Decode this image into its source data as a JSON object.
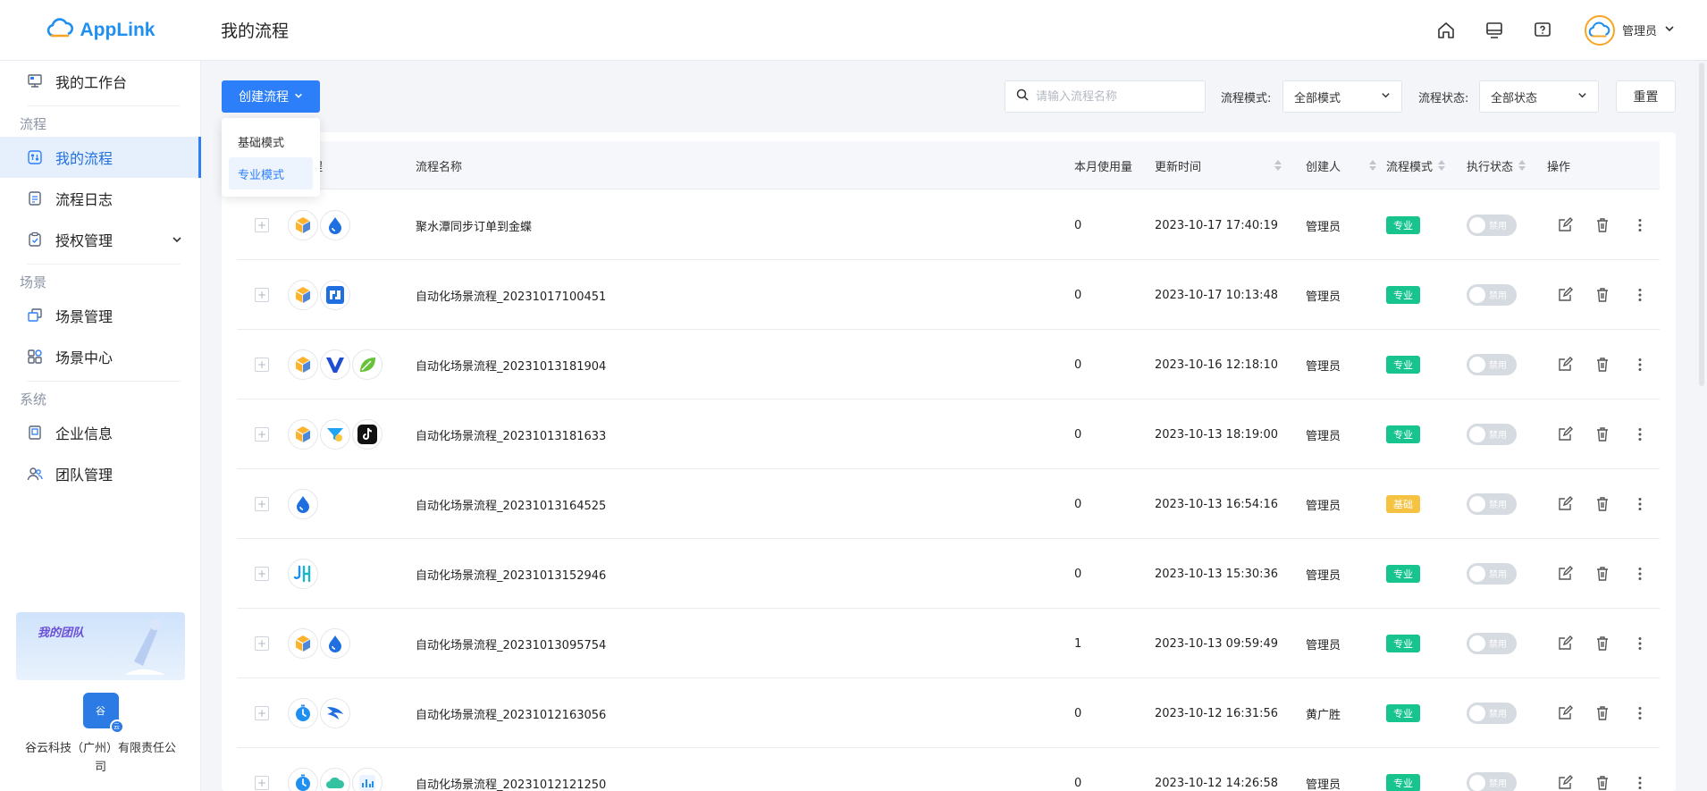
{
  "app": {
    "name": "AppLink",
    "page_title": "我的流程"
  },
  "header": {
    "user_name": "管理员"
  },
  "sidebar": {
    "top_item": "我的工作台",
    "sections": [
      {
        "label": "流程",
        "items": [
          "我的流程",
          "流程日志",
          "授权管理"
        ]
      },
      {
        "label": "场景",
        "items": [
          "场景管理",
          "场景中心"
        ]
      },
      {
        "label": "系统",
        "items": [
          "企业信息",
          "团队管理"
        ]
      }
    ],
    "active": "我的流程",
    "team_card": {
      "title": "我的团队",
      "logo_text": "谷",
      "badge_text": "云",
      "company": "谷云科技（广州）有限责任公司"
    }
  },
  "toolbar": {
    "create_label": "创建流程",
    "search_placeholder": "请输入流程名称",
    "mode_label": "流程模式:",
    "mode_value": "全部模式",
    "status_label": "流程状态:",
    "status_value": "全部状态",
    "reset_label": "重置"
  },
  "dropdown": {
    "items": [
      "基础模式",
      "专业模式"
    ],
    "selected": "专业模式"
  },
  "table": {
    "columns": [
      "流程",
      "流程名称",
      "本月使用量",
      "更新时间",
      "创建人",
      "流程模式",
      "执行状态",
      "操作"
    ],
    "rows": [
      {
        "name": "聚水潭同步订单到金蝶",
        "usage": "0",
        "updated": "2023-10-17 17:40:19",
        "creator": "管理员",
        "mode": "专业",
        "status": "禁用",
        "icons": [
          "box",
          "drop"
        ]
      },
      {
        "name": "自动化场景流程_20231017100451",
        "usage": "0",
        "updated": "2023-10-17 10:13:48",
        "creator": "管理员",
        "mode": "专业",
        "status": "禁用",
        "icons": [
          "box",
          "tcode"
        ]
      },
      {
        "name": "自动化场景流程_20231013181904",
        "usage": "0",
        "updated": "2023-10-16 12:18:10",
        "creator": "管理员",
        "mode": "专业",
        "status": "禁用",
        "icons": [
          "box",
          "v",
          "leaf"
        ]
      },
      {
        "name": "自动化场景流程_20231013181633",
        "usage": "0",
        "updated": "2023-10-13 18:19:00",
        "creator": "管理员",
        "mode": "专业",
        "status": "禁用",
        "icons": [
          "box",
          "funnel",
          "tiktok"
        ]
      },
      {
        "name": "自动化场景流程_20231013164525",
        "usage": "0",
        "updated": "2023-10-13 16:54:16",
        "creator": "管理员",
        "mode": "基础",
        "status": "禁用",
        "icons": [
          "drop"
        ]
      },
      {
        "name": "自动化场景流程_20231013152946",
        "usage": "0",
        "updated": "2023-10-13 15:30:36",
        "creator": "管理员",
        "mode": "专业",
        "status": "禁用",
        "icons": [
          "jh"
        ]
      },
      {
        "name": "自动化场景流程_20231013095754",
        "usage": "1",
        "updated": "2023-10-13 09:59:49",
        "creator": "管理员",
        "mode": "专业",
        "status": "禁用",
        "icons": [
          "box",
          "drop"
        ]
      },
      {
        "name": "自动化场景流程_20231012163056",
        "usage": "0",
        "updated": "2023-10-12 16:31:56",
        "creator": "黄广胜",
        "mode": "专业",
        "status": "禁用",
        "icons": [
          "timer",
          "swirl"
        ]
      },
      {
        "name": "自动化场景流程_20231012121250",
        "usage": "0",
        "updated": "2023-10-12 14:26:58",
        "creator": "管理员",
        "mode": "专业",
        "status": "禁用",
        "icons": [
          "timer",
          "cloud",
          "chart"
        ]
      }
    ]
  },
  "colors": {
    "primary": "#2d7ff9",
    "pro_tag": "#17c48e",
    "basic_tag": "#f5c242"
  }
}
